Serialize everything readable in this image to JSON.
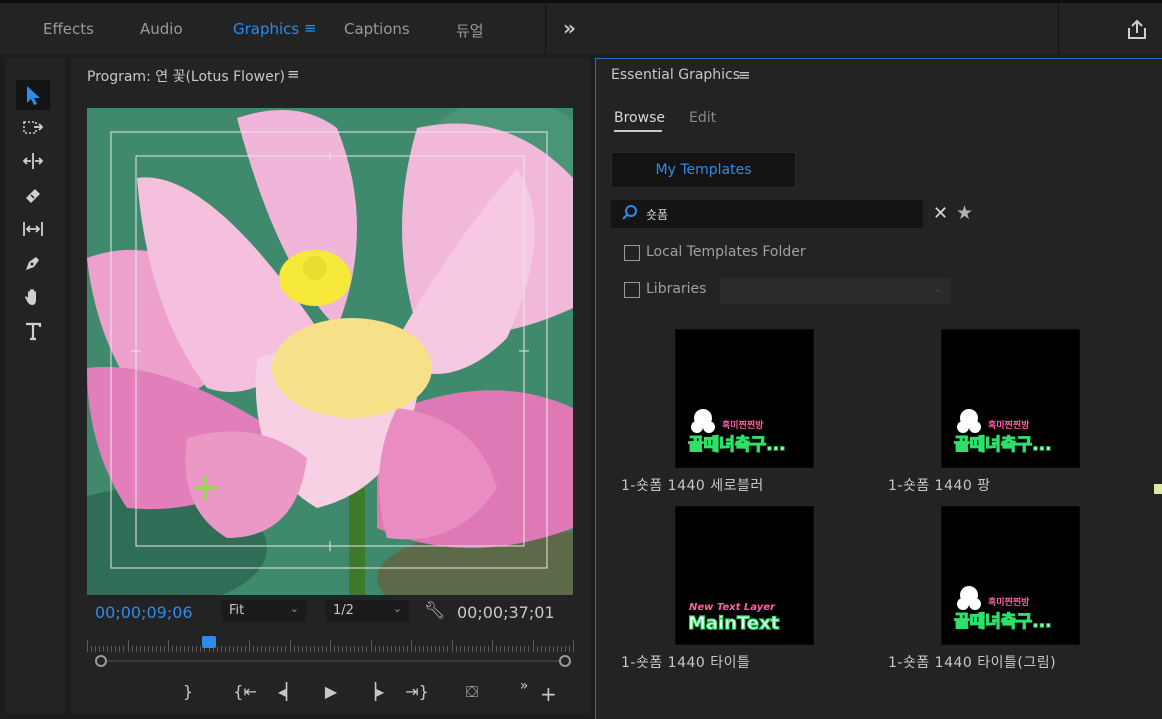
{
  "workspace": {
    "tabs": [
      "Effects",
      "Audio",
      "Graphics",
      "Captions",
      "듀얼"
    ],
    "active_tab": "Graphics"
  },
  "program": {
    "title": "Program: 연 꽃(Lotus Flower)",
    "current_timecode": "00;00;09;06",
    "duration_timecode": "00;00;37;01",
    "zoom": "Fit",
    "resolution": "1/2",
    "playhead_position": 0.25
  },
  "essential_graphics": {
    "title": "Essential Graphics",
    "tabs": [
      "Browse",
      "Edit"
    ],
    "active_tab": "Browse",
    "my_templates_label": "My Templates",
    "search_value": "숏폼",
    "local_templates_label": "Local Templates Folder",
    "libraries_label": "Libraries",
    "templates": [
      {
        "label": "1-숏폼 1440 세로블러",
        "thumb_text_top": "흑미찐찐방",
        "thumb_text_main": "골때녀축구..."
      },
      {
        "label": "1-숏폼 1440 팡",
        "thumb_text_top": "흑미찐찐방",
        "thumb_text_main": "골때녀축구..."
      },
      {
        "label": "1-숏폼 1440 타이틀",
        "thumb_text_top": "New Text Layer",
        "thumb_text_main": "MainText"
      },
      {
        "label": "1-숏폼 1440 타이틀(그림)",
        "thumb_text_top": "흑미찐찐방",
        "thumb_text_main": "골때녀축구..."
      }
    ]
  },
  "colors": {
    "accent": "#2d8ceb",
    "panel_bg": "#232323",
    "thumb_pink": "#ff5fa8",
    "thumb_green": "#2ee06a"
  }
}
